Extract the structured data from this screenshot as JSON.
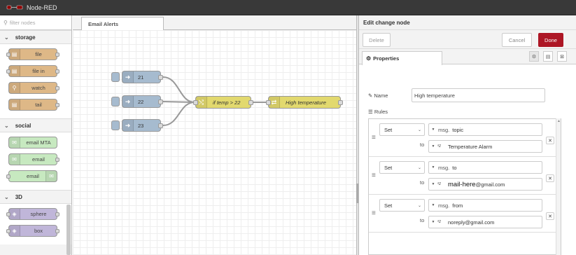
{
  "app": {
    "title": "Node-RED"
  },
  "palette": {
    "filter_placeholder": "filter nodes",
    "categories": [
      {
        "name": "storage",
        "nodes": [
          "file",
          "file in",
          "watch",
          "tail"
        ]
      },
      {
        "name": "social",
        "nodes": [
          "email MTA",
          "email",
          "email"
        ]
      },
      {
        "name": "3D",
        "nodes": [
          "sphere",
          "box"
        ]
      }
    ]
  },
  "workspace": {
    "tab_label": "Email Alerts",
    "nodes": {
      "inject_1": "21",
      "inject_2": "22",
      "inject_3": "23",
      "switch": "if temp > 22",
      "change": "High temperature"
    }
  },
  "tray": {
    "title": "Edit change node",
    "delete_label": "Delete",
    "cancel_label": "Cancel",
    "done_label": "Done",
    "properties_tab": "Properties",
    "name_label": "Name",
    "name_value": "High temperature",
    "rules_label": "Rules",
    "to_label": "to",
    "rules": [
      {
        "action": "Set",
        "prop_prefix": "msg.",
        "prop": "topic",
        "value": "Temperature Alarm"
      },
      {
        "action": "Set",
        "prop_prefix": "msg.",
        "prop": "to",
        "value_main": "mail-here",
        "value_suffix": "@gmail.com"
      },
      {
        "action": "Set",
        "prop_prefix": "msg.",
        "prop": "from",
        "value": "noreply@gmail.com"
      }
    ]
  },
  "colors": {
    "header_bg": "#393939",
    "inject_node": "#a6bbcf",
    "function_node": "#e2d96e",
    "storage_node": "#deb887",
    "social_node": "#c0deed",
    "email_node": "#c7e9c0",
    "d3_node": "#c0b6d9",
    "done_button": "#ad1625"
  }
}
